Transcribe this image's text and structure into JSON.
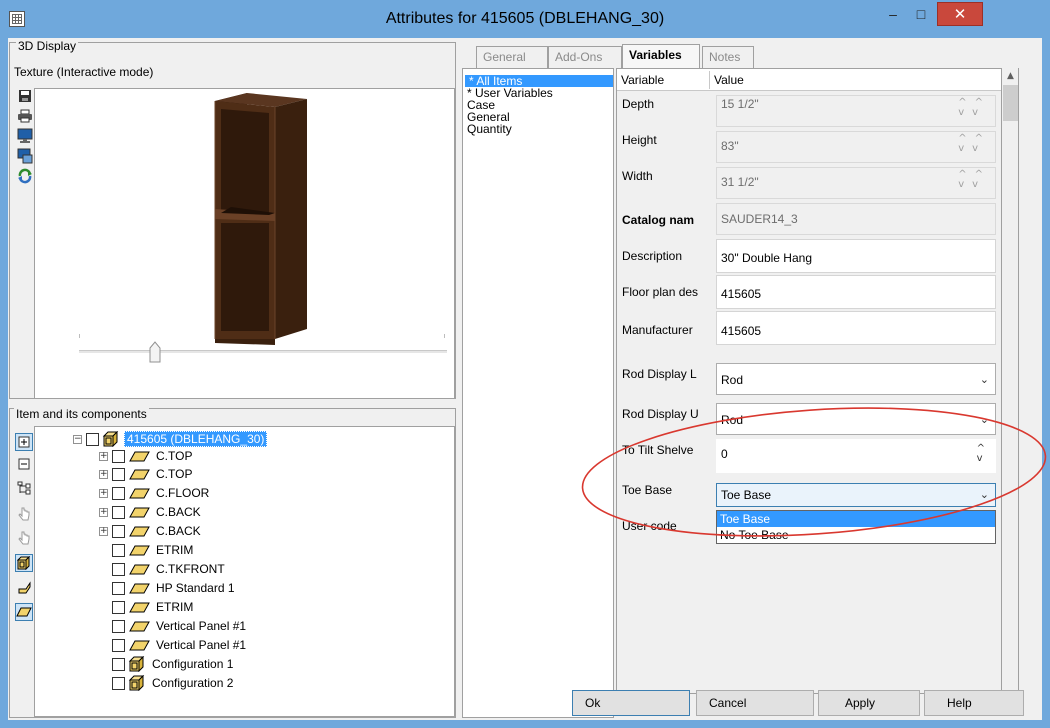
{
  "window": {
    "title": "Attributes for 415605 (DBLEHANG_30)",
    "minimize_glyph": "–",
    "maximize_glyph": "□",
    "close_glyph": "✕"
  },
  "display": {
    "group_label": "3D Display",
    "texture_label": "Texture (Interactive mode)",
    "tools": [
      "save-icon",
      "print-icon",
      "monitor-icon",
      "export-icon",
      "refresh-icon"
    ]
  },
  "components": {
    "group_label": "Item and its components",
    "tools": [
      "expand-all-icon",
      "collapse-all-icon",
      "hierarchy-icon",
      "pointer-icon",
      "pointer-alt-icon",
      "cube-icon",
      "panel-side-icon",
      "panel-flat-icon"
    ],
    "tree": [
      {
        "label": "415605 (DBLEHANG_30)",
        "expander": "−",
        "icon": "configuration",
        "level": 0,
        "selected": true
      },
      {
        "label": "C.TOP",
        "expander": "+",
        "icon": "panel",
        "level": 1
      },
      {
        "label": "C.TOP",
        "expander": "+",
        "icon": "panel",
        "level": 1
      },
      {
        "label": "C.FLOOR",
        "expander": "+",
        "icon": "panel",
        "level": 1
      },
      {
        "label": "C.BACK",
        "expander": "+",
        "icon": "panel",
        "level": 1
      },
      {
        "label": "C.BACK",
        "expander": "+",
        "icon": "panel",
        "level": 1
      },
      {
        "label": "ETRIM",
        "expander": "",
        "icon": "panel",
        "level": 1
      },
      {
        "label": "C.TKFRONT",
        "expander": "",
        "icon": "panel",
        "level": 1
      },
      {
        "label": "HP Standard 1",
        "expander": "",
        "icon": "panel",
        "level": 1
      },
      {
        "label": "ETRIM",
        "expander": "",
        "icon": "panel",
        "level": 1
      },
      {
        "label": "Vertical Panel #1",
        "expander": "",
        "icon": "panel",
        "level": 1
      },
      {
        "label": "Vertical Panel #1",
        "expander": "",
        "icon": "panel",
        "level": 1
      },
      {
        "label": "Configuration 1",
        "expander": "",
        "icon": "configuration",
        "level": 1
      },
      {
        "label": "Configuration 2",
        "expander": "",
        "icon": "configuration",
        "level": 1
      }
    ]
  },
  "tabs": [
    {
      "label": "General",
      "active": false
    },
    {
      "label": "Add-Ons",
      "active": false
    },
    {
      "label": "Variables",
      "active": true
    },
    {
      "label": "Notes",
      "active": false
    }
  ],
  "categories": [
    "* All Items",
    "* User Variables",
    "Case",
    "General",
    "Quantity"
  ],
  "variables": {
    "header": {
      "variable": "Variable",
      "value": "Value"
    },
    "rows": [
      {
        "name": "Depth",
        "value": "15 1/2\"",
        "kind": "spin-disabled"
      },
      {
        "name": "Height",
        "value": "83\"",
        "kind": "spin-disabled"
      },
      {
        "name": "Width",
        "value": "31 1/2\"",
        "kind": "spin-disabled"
      },
      {
        "name": "Catalog nam",
        "value": "SAUDER14_3",
        "kind": "disabled"
      },
      {
        "name": "Description",
        "value": "30\" Double Hang",
        "kind": "text"
      },
      {
        "name": "Floor plan des",
        "value": "415605",
        "kind": "text"
      },
      {
        "name": "Manufacturer",
        "value": "415605",
        "kind": "text"
      },
      {
        "name": "Rod Display L",
        "value": "Rod",
        "kind": "select"
      },
      {
        "name": "Rod Display U",
        "value": "Rod",
        "kind": "select"
      },
      {
        "name": "To Tilt Shelve",
        "value": "0",
        "kind": "spin"
      },
      {
        "name": "Toe Base",
        "value": "Toe Base",
        "kind": "select-open"
      },
      {
        "name": "User code",
        "value": "",
        "kind": "hidden"
      }
    ]
  },
  "dropdown": {
    "options": [
      "Toe Base",
      "No Toe Base"
    ],
    "selected_index": 0
  },
  "buttons": {
    "ok": "Ok",
    "cancel": "Cancel",
    "apply": "Apply",
    "help": "Help"
  },
  "colors": {
    "titlebar": "#6fa8dc",
    "close_button": "#c9483c",
    "selection": "#3399ff",
    "annotation": "#d9382f",
    "cabinet_wood": "#4a2a14"
  }
}
